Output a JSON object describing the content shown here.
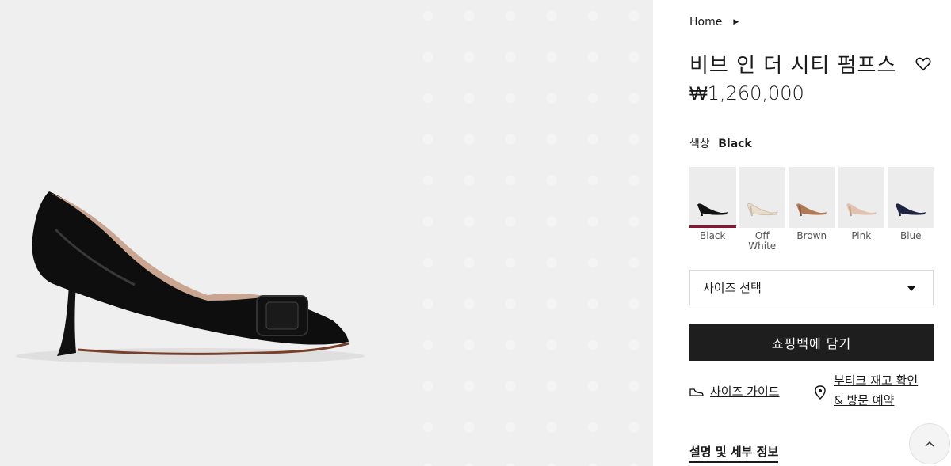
{
  "gallery": {
    "image_alt": "black patent pump with buckle",
    "image_icon": "shoe-product-image"
  },
  "breadcrumb": {
    "home": "Home"
  },
  "product": {
    "title": "비브 인 더 시티 펌프스",
    "price": "₩1,260,000",
    "color_label": "색상",
    "color_value": "Black"
  },
  "swatches": [
    {
      "label": "Black",
      "color": "#111111"
    },
    {
      "label": "Off\nWhite",
      "color": "#e8dccb"
    },
    {
      "label": "Brown",
      "color": "#b07a56"
    },
    {
      "label": "Pink",
      "color": "#e0c2ae"
    },
    {
      "label": "Blue",
      "color": "#1e2440"
    }
  ],
  "size": {
    "placeholder": "사이즈 선택"
  },
  "actions": {
    "add_to_bag": "쇼핑백에 담기",
    "size_guide": "사이즈 가이드",
    "stock_line1": "부티크 재고 확인",
    "stock_line2": "& 방문 예약"
  },
  "details": {
    "label": "설명 및 세부 정보"
  },
  "colors": {
    "accent": "#8b1535",
    "button": "#1e1e1e",
    "gallery_bg": "#efefef"
  }
}
